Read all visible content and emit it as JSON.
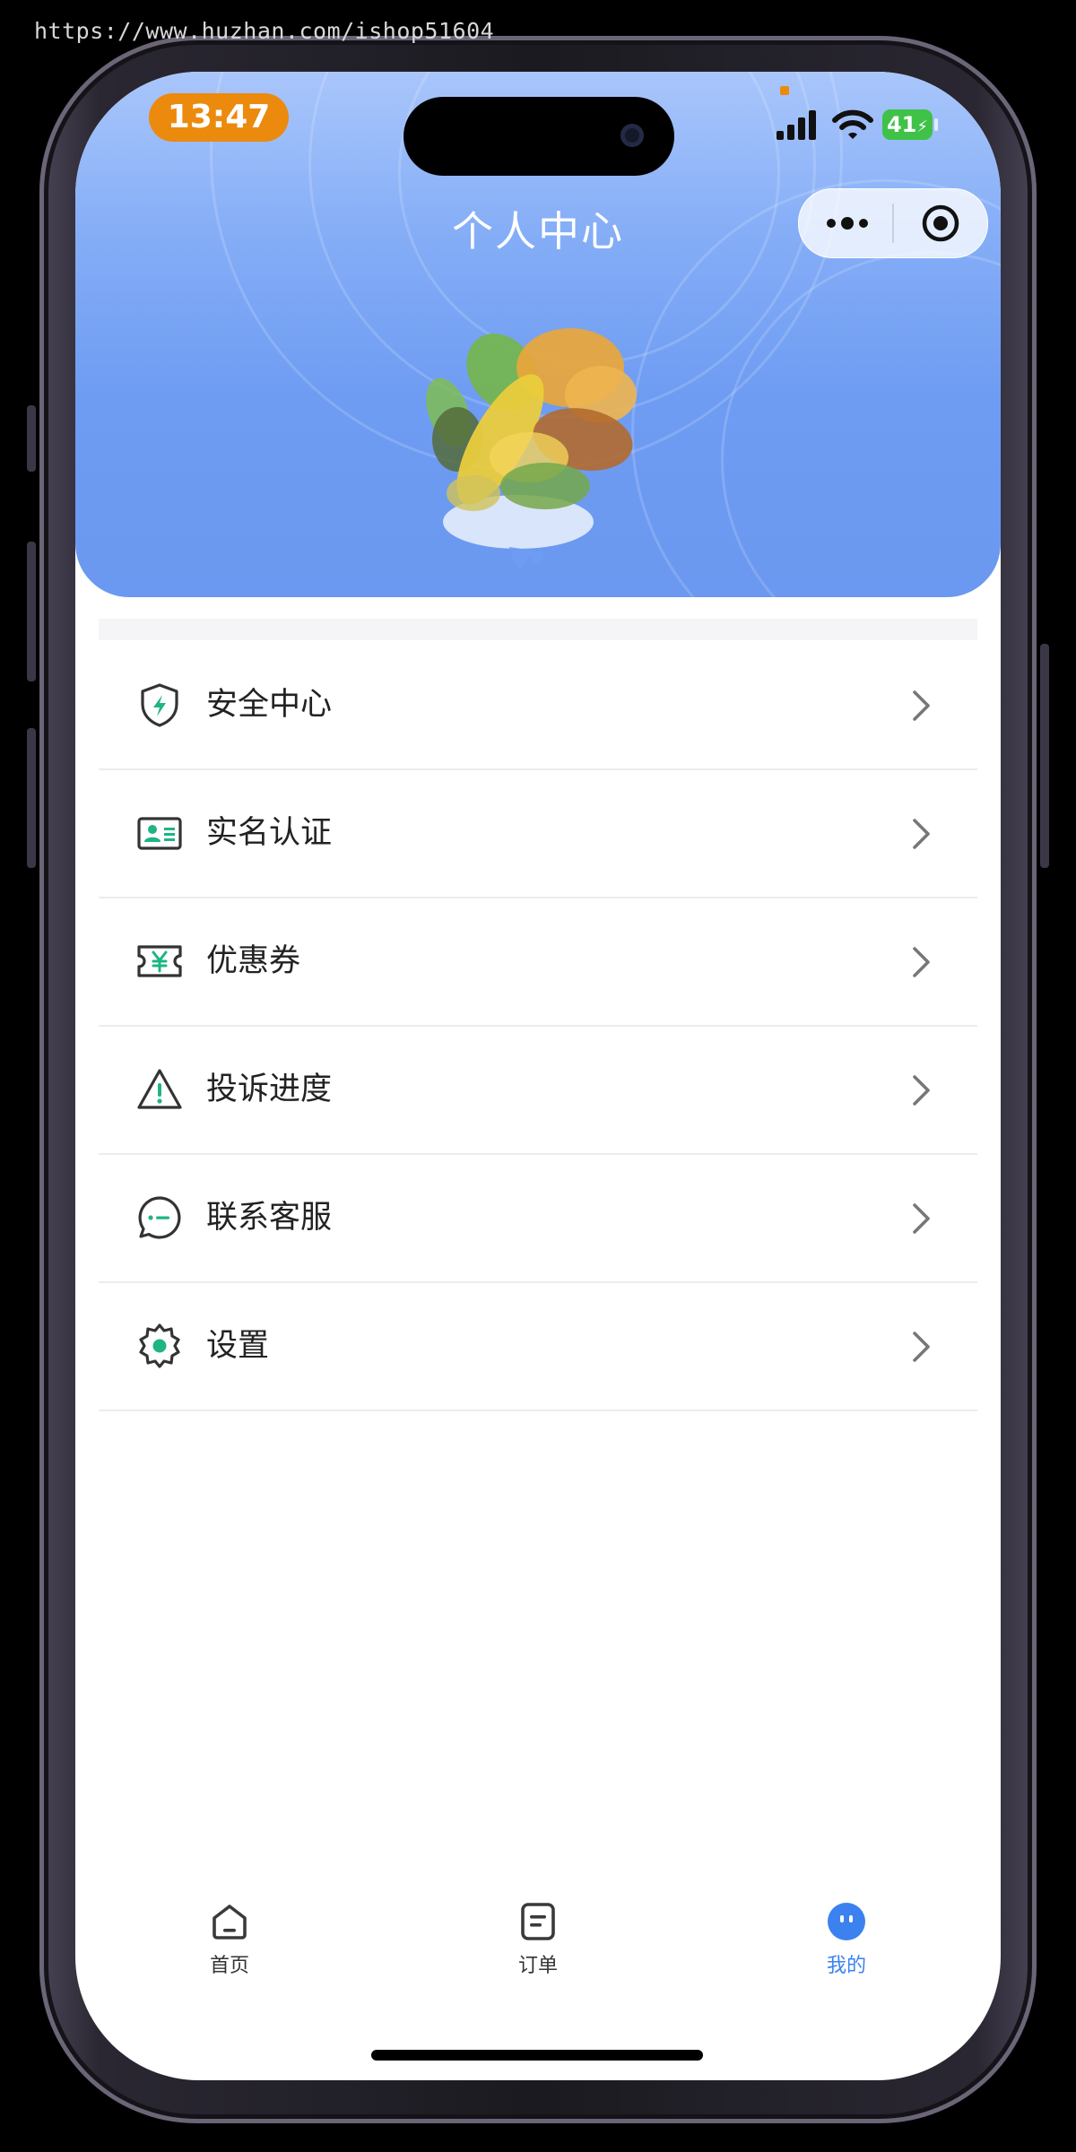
{
  "watermark": "https://www.huzhan.com/ishop51604",
  "status_bar": {
    "time": "13:47",
    "battery": "41",
    "time_pill_color": "#ec8a0d",
    "battery_color": "#3fc247",
    "icons": [
      "cellular-signal-icon",
      "wifi-icon",
      "battery-charging-icon"
    ]
  },
  "header": {
    "title": "个人中心",
    "gradient": [
      "#a9c6fb",
      "#6b98f0"
    ],
    "capsule_icons": [
      "more-dots-icon",
      "close-target-icon"
    ]
  },
  "menu": {
    "accent_color": "#1fb486",
    "items": [
      {
        "label": "安全中心",
        "icon": "shield-bolt-icon"
      },
      {
        "label": "实名认证",
        "icon": "id-card-icon"
      },
      {
        "label": "优惠券",
        "icon": "coupon-yen-icon"
      },
      {
        "label": "投诉进度",
        "icon": "warning-triangle-icon"
      },
      {
        "label": "联系客服",
        "icon": "chat-bubble-icon"
      },
      {
        "label": "设置",
        "icon": "settings-gear-icon"
      }
    ]
  },
  "tabbar": {
    "active_color": "#3b82f0",
    "tabs": [
      {
        "label": "首页",
        "icon": "home-icon",
        "active": false
      },
      {
        "label": "订单",
        "icon": "order-icon",
        "active": false
      },
      {
        "label": "我的",
        "icon": "profile-face-icon",
        "active": true
      }
    ]
  }
}
